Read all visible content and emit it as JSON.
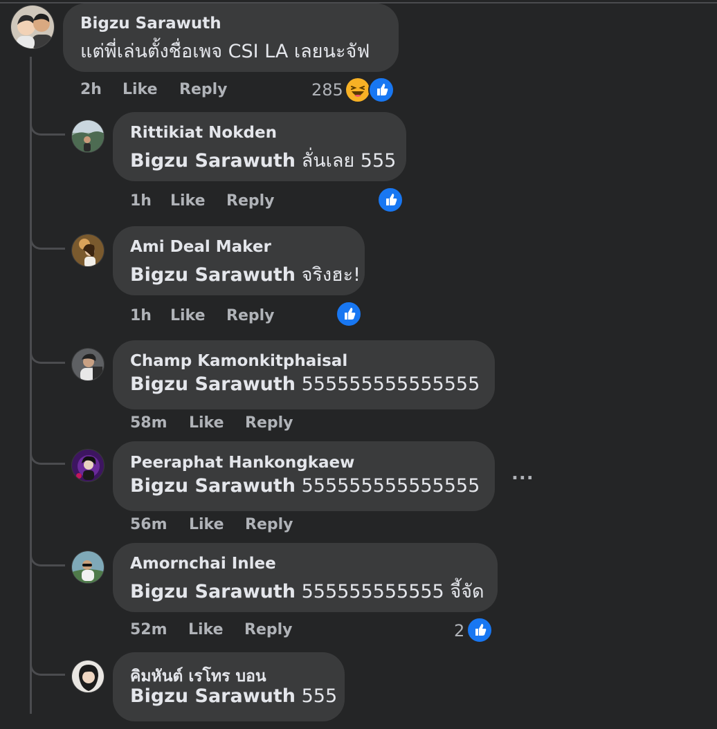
{
  "colors": {
    "background": "#242526",
    "bubble": "#3a3b3c",
    "like_blue": "#1877f2",
    "meta_text": "#b0b3b8"
  },
  "main_comment": {
    "author": "Bigzu Sarawuth",
    "text": "แต่พี่เล่นตั้งชื่อเพจ CSI LA เลยนะจัฟ",
    "time": "2h",
    "like_label": "Like",
    "reply_label": "Reply",
    "reaction_count": "285",
    "reactions": [
      "haha-icon",
      "like-icon"
    ]
  },
  "replies": [
    {
      "author": "Rittikiat Nokden",
      "tag": "Bigzu Sarawuth",
      "text": "ลั่นเลย 555",
      "time": "1h",
      "like_label": "Like",
      "reply_label": "Reply",
      "reaction_count": "",
      "reactions": [
        "like-icon"
      ]
    },
    {
      "author": "Ami Deal Maker",
      "tag": "Bigzu Sarawuth",
      "text": "จริงฮะ!",
      "time": "1h",
      "like_label": "Like",
      "reply_label": "Reply",
      "reaction_count": "",
      "reactions": [
        "like-icon"
      ]
    },
    {
      "author": "Champ Kamonkitphaisal",
      "tag": "Bigzu Sarawuth",
      "text": "555555555555555",
      "time": "58m",
      "like_label": "Like",
      "reply_label": "Reply",
      "reaction_count": "",
      "reactions": []
    },
    {
      "author": "Peeraphat Hankongkaew",
      "tag": "Bigzu Sarawuth",
      "text": "555555555555555",
      "time": "56m",
      "like_label": "Like",
      "reply_label": "Reply",
      "reaction_count": "",
      "reactions": [],
      "more_options": "..."
    },
    {
      "author": "Amornchai Inlee",
      "tag": "Bigzu Sarawuth",
      "text": "555555555555 จี้จัด",
      "time": "52m",
      "like_label": "Like",
      "reply_label": "Reply",
      "reaction_count": "2",
      "reactions": [
        "like-icon"
      ]
    },
    {
      "author": "คิมหันต์ เรโทร บอน",
      "tag": "Bigzu Sarawuth",
      "text": "555",
      "time": "",
      "like_label": "",
      "reply_label": "",
      "reaction_count": "",
      "reactions": []
    }
  ]
}
